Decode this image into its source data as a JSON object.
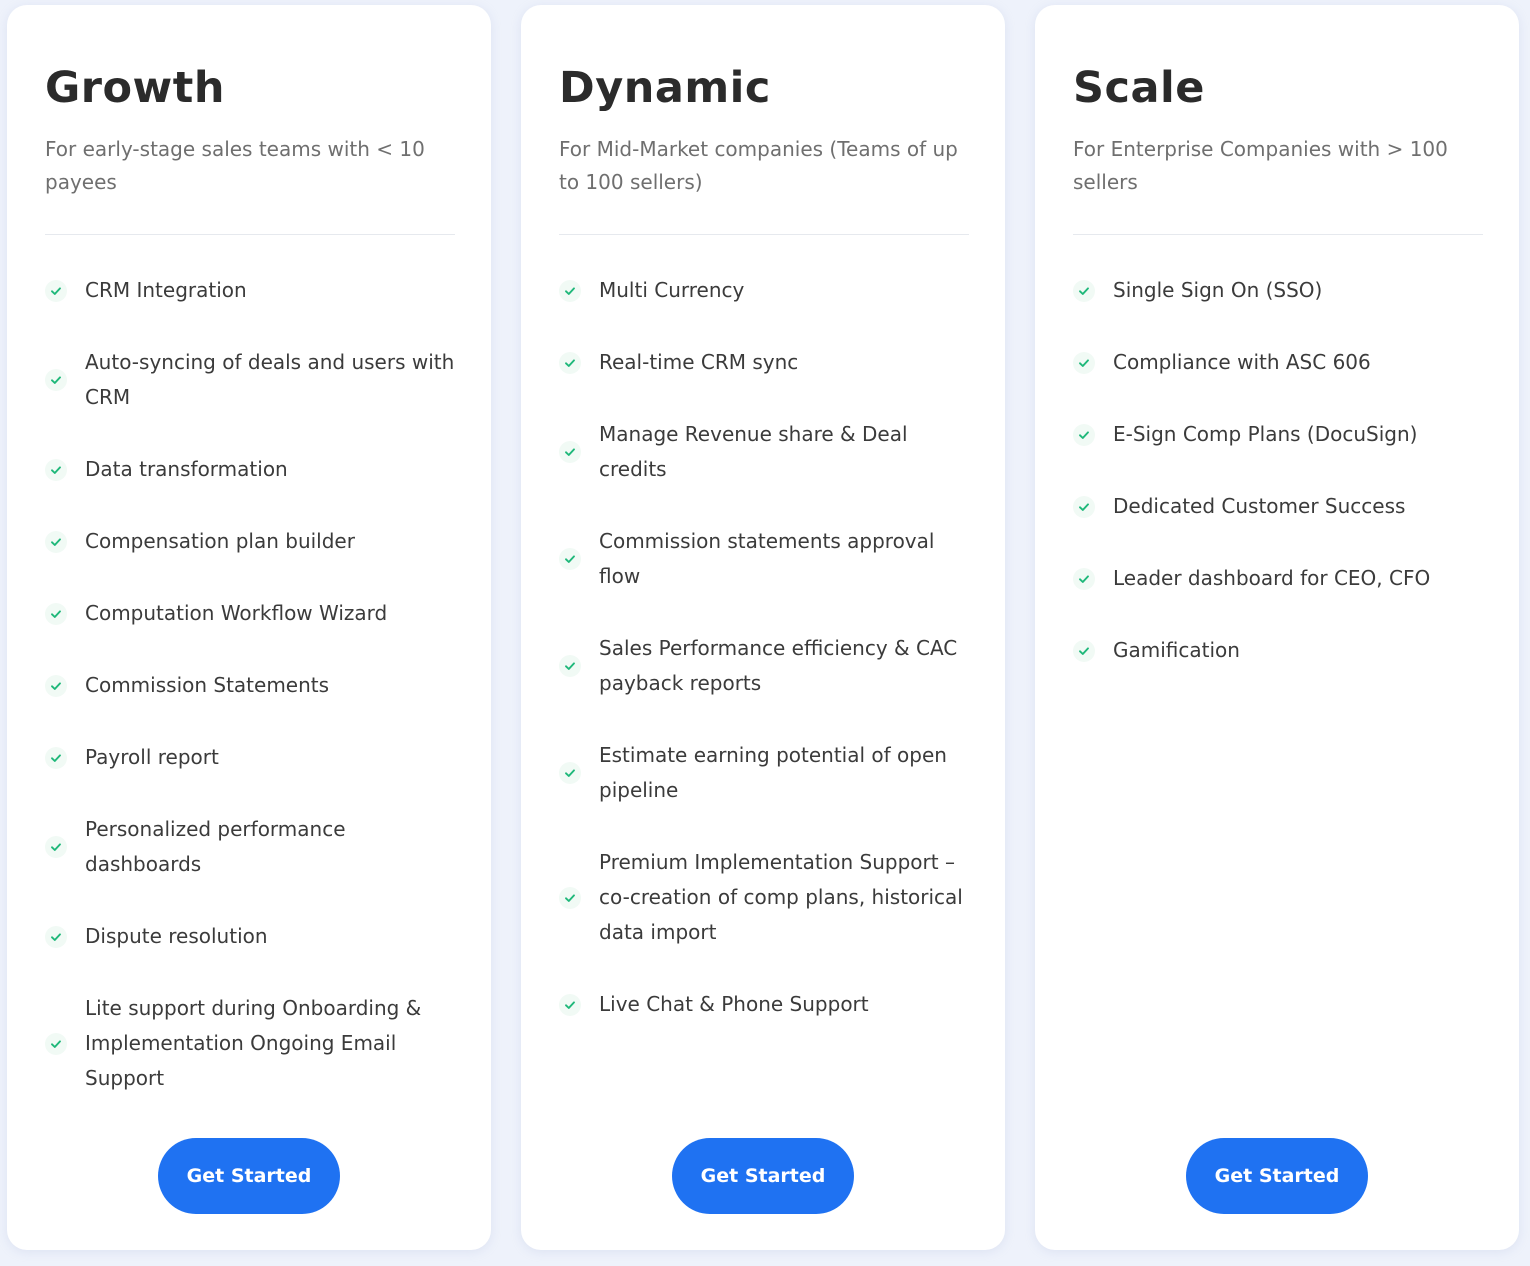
{
  "colors": {
    "page_background": "#eef2fb",
    "card_background": "#ffffff",
    "accent_button": "#1f72f2",
    "check_green": "#1fb87a",
    "title_text": "#2b2b2b",
    "description_text": "#6f6f6f",
    "feature_text": "#3b3b3b"
  },
  "plans": [
    {
      "title": "Growth",
      "description": "For early-stage sales teams with < 10 payees",
      "features": [
        "CRM Integration",
        "Auto-syncing of deals and users with CRM",
        "Data transformation",
        "Compensation plan builder",
        "Computation Workflow Wizard",
        "Commission Statements",
        "Payroll report",
        "Personalized performance dashboards",
        "Dispute resolution",
        "Lite support during Onboarding & Implementation Ongoing Email Support"
      ],
      "cta_label": "Get Started",
      "feature_icon": "check-icon"
    },
    {
      "title": "Dynamic",
      "description": "For Mid-Market companies (Teams of up to 100 sellers)",
      "features": [
        "Multi Currency",
        "Real-time CRM sync",
        "Manage Revenue share & Deal credits",
        "Commission statements approval flow",
        "Sales Performance efficiency & CAC payback reports",
        "Estimate earning potential of open pipeline",
        "Premium Implementation Support – co-creation of comp plans, historical data import",
        "Live Chat & Phone Support"
      ],
      "cta_label": "Get Started",
      "feature_icon": "check-icon"
    },
    {
      "title": "Scale",
      "description": "For Enterprise Companies with > 100 sellers",
      "features": [
        "Single Sign On (SSO)",
        "Compliance with ASC 606",
        "E-Sign Comp Plans (DocuSign)",
        "Dedicated Customer Success",
        "Leader dashboard for CEO, CFO",
        "Gamification"
      ],
      "cta_label": "Get Started",
      "feature_icon": "check-icon"
    }
  ]
}
